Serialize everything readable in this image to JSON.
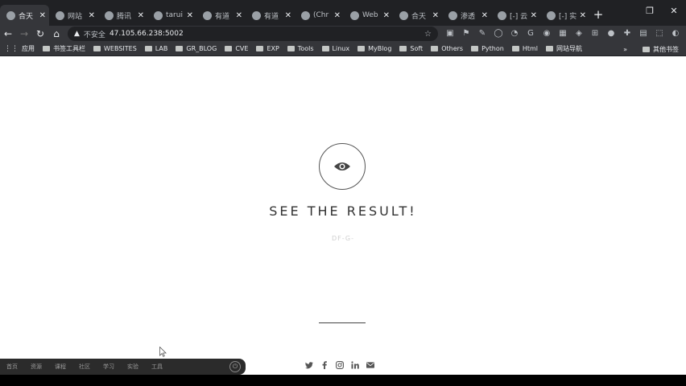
{
  "tabs": [
    {
      "title": "合天",
      "active": true
    },
    {
      "title": "网站",
      "active": false
    },
    {
      "title": "腾讯",
      "active": false
    },
    {
      "title": "tarui",
      "active": false
    },
    {
      "title": "有道",
      "active": false
    },
    {
      "title": "有道",
      "active": false
    },
    {
      "title": "(Chr",
      "active": false
    },
    {
      "title": "Web",
      "active": false
    },
    {
      "title": "合天",
      "active": false
    },
    {
      "title": "渗透",
      "active": false
    },
    {
      "title": "[-] 云配",
      "active": false
    },
    {
      "title": "[-] 实例",
      "active": false
    }
  ],
  "newtab_label": "+",
  "toolbar": {
    "security_label": "不安全",
    "url": "47.105.66.238:5002"
  },
  "bookmarks": {
    "apps_label": "应用",
    "items": [
      "书签工具栏",
      "WEBSITES",
      "LAB",
      "GR_BLOG",
      "CVE",
      "EXP",
      "Tools",
      "Linux",
      "MyBlog",
      "Soft",
      "Others",
      "Python",
      "Html",
      "网站导航"
    ],
    "more_label": "»",
    "other_label": "其他书签"
  },
  "main": {
    "headline": "SEE THE RESULT!",
    "subtext": "DF-G-"
  },
  "taskbar": {
    "items": [
      "首页",
      "资源",
      "课程",
      "社区",
      "学习",
      "实验",
      "工具"
    ]
  },
  "icons": {
    "eye": "eye-icon",
    "social": [
      "twitter-icon",
      "facebook-icon",
      "instagram-icon",
      "linkedin-icon",
      "mail-icon"
    ]
  }
}
